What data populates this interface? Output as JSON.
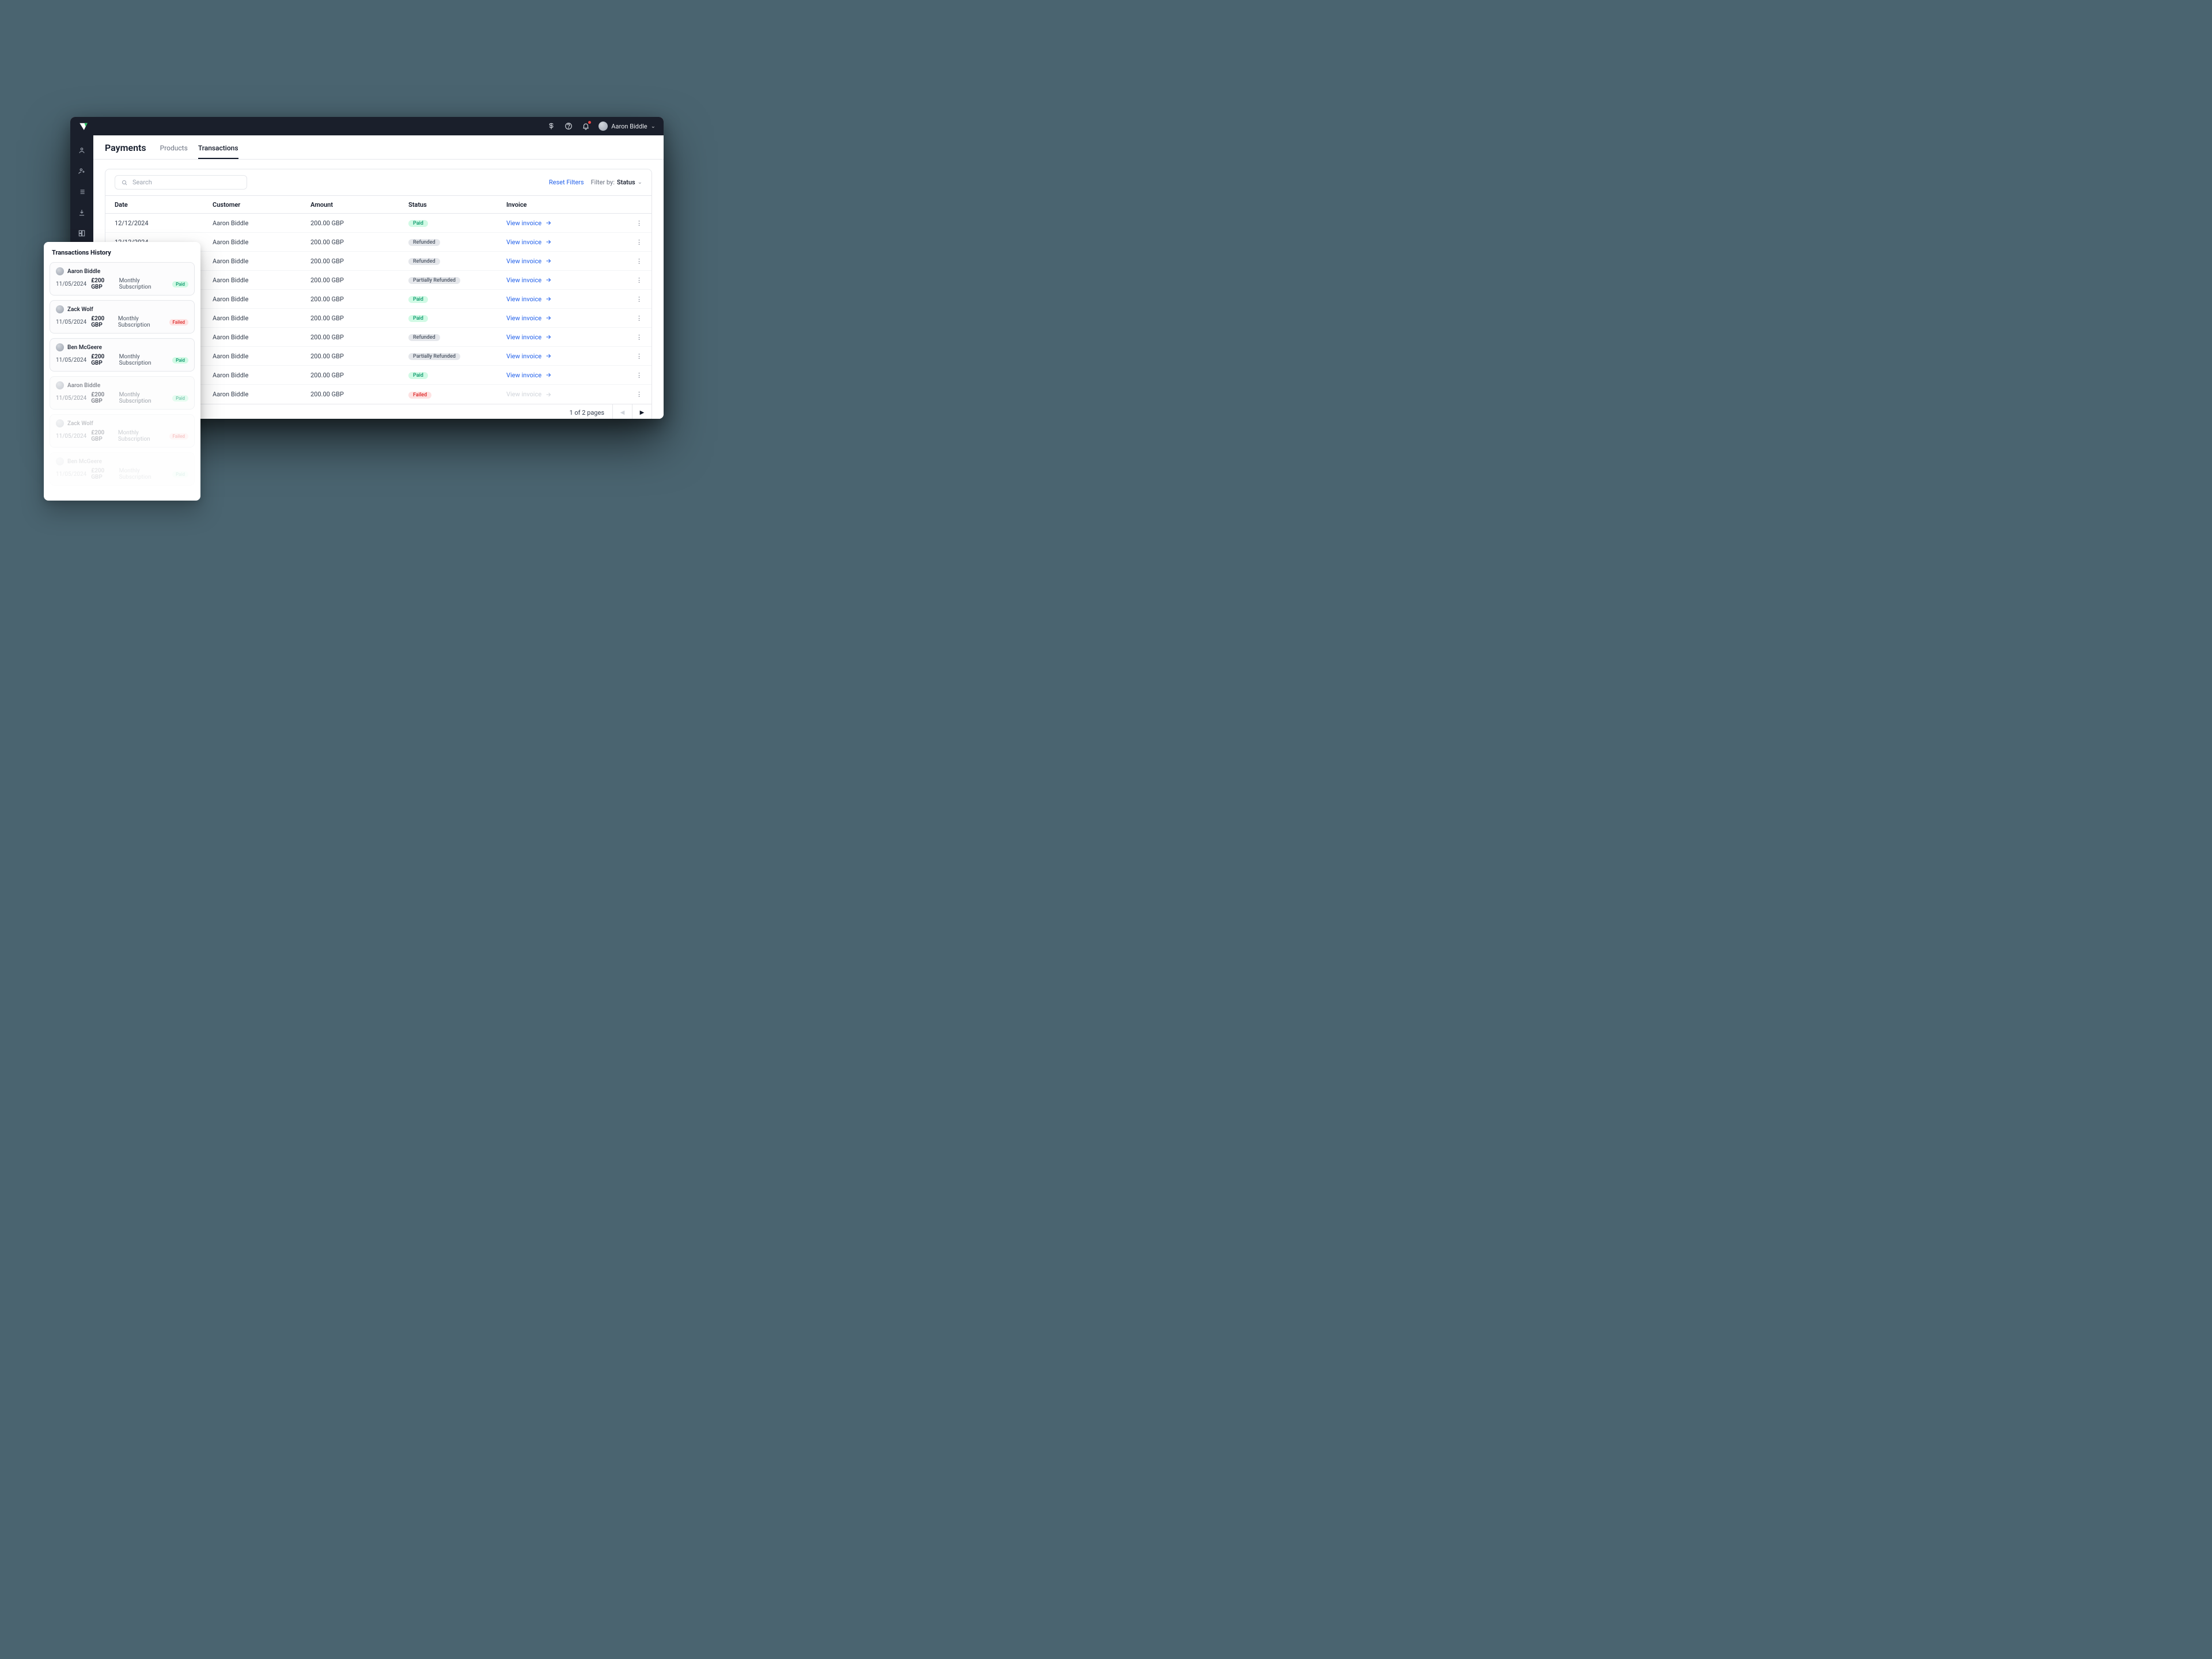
{
  "topbar": {
    "user_name": "Aaron Biddle"
  },
  "page": {
    "title": "Payments",
    "tabs": [
      {
        "label": "Products",
        "active": false
      },
      {
        "label": "Transactions",
        "active": true
      }
    ]
  },
  "filters": {
    "search_placeholder": "Search",
    "reset_label": "Reset Filters",
    "filter_by_label": "Filter by:",
    "filter_by_value": "Status"
  },
  "table": {
    "columns": [
      "Date",
      "Customer",
      "Amount",
      "Status",
      "Invoice"
    ],
    "invoice_link_label": "View invoice",
    "rows": [
      {
        "date": "12/12/2024",
        "customer": "Aaron Biddle",
        "amount": "200.00 GBP",
        "status": "Paid",
        "status_kind": "paid",
        "invoice_enabled": true
      },
      {
        "date": "12/12/2024",
        "customer": "Aaron Biddle",
        "amount": "200.00 GBP",
        "status": "Refunded",
        "status_kind": "refunded",
        "invoice_enabled": true
      },
      {
        "date": "",
        "customer": "Aaron Biddle",
        "amount": "200.00 GBP",
        "status": "Refunded",
        "status_kind": "refunded",
        "invoice_enabled": true
      },
      {
        "date": "",
        "customer": "Aaron Biddle",
        "amount": "200.00 GBP",
        "status": "Partially Refunded",
        "status_kind": "partial",
        "invoice_enabled": true
      },
      {
        "date": "",
        "customer": "Aaron Biddle",
        "amount": "200.00 GBP",
        "status": "Paid",
        "status_kind": "paid",
        "invoice_enabled": true
      },
      {
        "date": "",
        "customer": "Aaron Biddle",
        "amount": "200.00 GBP",
        "status": "Paid",
        "status_kind": "paid",
        "invoice_enabled": true
      },
      {
        "date": "",
        "customer": "Aaron Biddle",
        "amount": "200.00 GBP",
        "status": "Refunded",
        "status_kind": "refunded",
        "invoice_enabled": true
      },
      {
        "date": "",
        "customer": "Aaron Biddle",
        "amount": "200.00 GBP",
        "status": "Partially Refunded",
        "status_kind": "partial",
        "invoice_enabled": true
      },
      {
        "date": "",
        "customer": "Aaron Biddle",
        "amount": "200.00 GBP",
        "status": "Paid",
        "status_kind": "paid",
        "invoice_enabled": true
      },
      {
        "date": "",
        "customer": "Aaron Biddle",
        "amount": "200.00 GBP",
        "status": "Failed",
        "status_kind": "failed",
        "invoice_enabled": false
      }
    ]
  },
  "pager": {
    "text": "1 of 2 pages"
  },
  "history": {
    "title": "Transactions History",
    "items": [
      {
        "name": "Aaron Biddle",
        "date": "11/05/2024",
        "amount": "£200 GBP",
        "plan": "Monthly Subscription",
        "status": "Paid",
        "status_kind": "paid",
        "fade": 0
      },
      {
        "name": "Zack Wolf",
        "date": "11/05/2024",
        "amount": "£200 GBP",
        "plan": "Monthly Subscription",
        "status": "Failed",
        "status_kind": "failed",
        "fade": 0
      },
      {
        "name": "Ben McGeere",
        "date": "11/05/2024",
        "amount": "£200 GBP",
        "plan": "Monthly Subscription",
        "status": "Paid",
        "status_kind": "paid",
        "fade": 0
      },
      {
        "name": "Aaron Biddle",
        "date": "11/05/2024",
        "amount": "£200 GBP",
        "plan": "Monthly Subscription",
        "status": "Paid",
        "status_kind": "paid",
        "fade": 1
      },
      {
        "name": "Zack Wolf",
        "date": "11/05/2024",
        "amount": "£200 GBP",
        "plan": "Monthly Subscription",
        "status": "Failed",
        "status_kind": "failed",
        "fade": 2
      },
      {
        "name": "Ben McGeere",
        "date": "11/05/2024",
        "amount": "£200 GBP",
        "plan": "Monthly Subscription",
        "status": "Paid",
        "status_kind": "paid",
        "fade": 3
      }
    ]
  }
}
